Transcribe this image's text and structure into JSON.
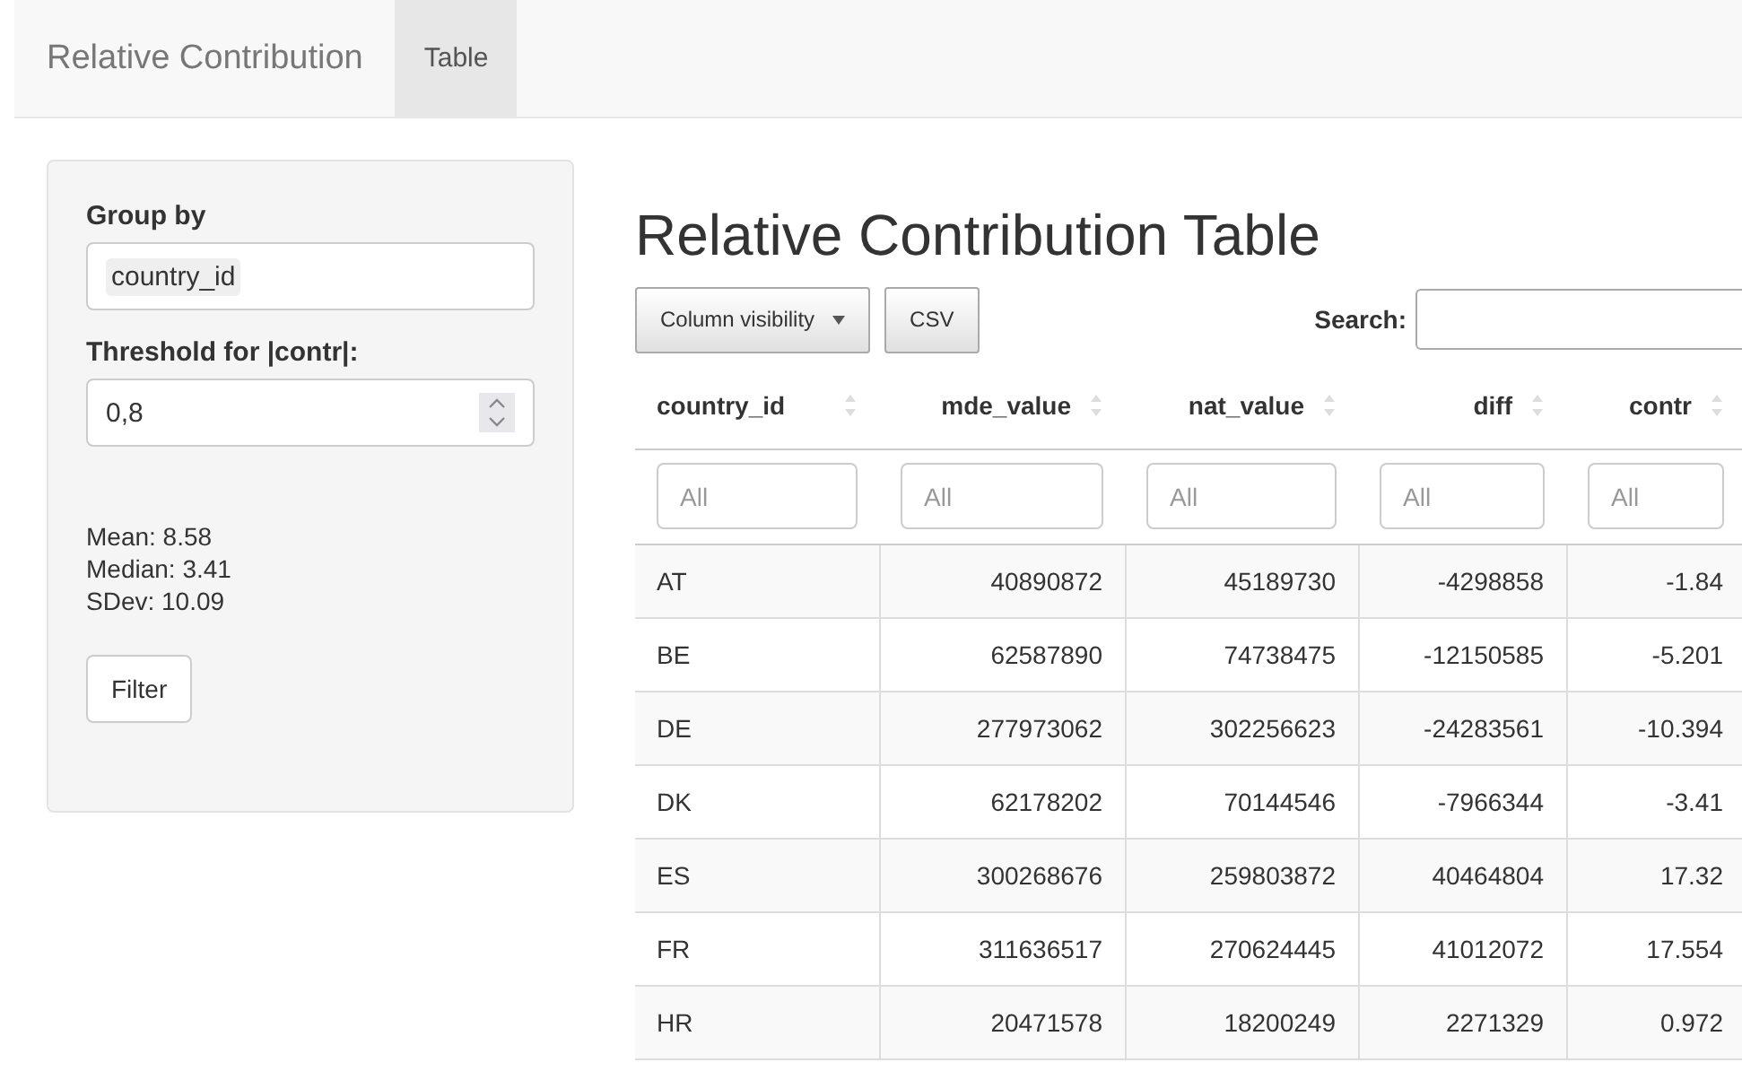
{
  "navbar": {
    "brand": "Relative Contribution",
    "tabs": [
      {
        "label": "Table",
        "selected": true
      }
    ]
  },
  "sidebar": {
    "group_by": {
      "label": "Group by",
      "value": "country_id"
    },
    "threshold": {
      "label": "Threshold for |contr|:",
      "value": "0,8"
    },
    "stats": [
      "Mean: 8.58",
      "Median: 3.41",
      "SDev: 10.09"
    ],
    "filter_button": "Filter"
  },
  "main": {
    "title": "Relative Contribution Table",
    "buttons": [
      {
        "label": "Column visibility",
        "kind": "dropdown"
      },
      {
        "label": "CSV",
        "kind": "plain"
      }
    ],
    "search_label": "Search:",
    "table": {
      "columns": [
        {
          "label": "country_id"
        },
        {
          "label": "mde_value"
        },
        {
          "label": "nat_value"
        },
        {
          "label": "diff"
        },
        {
          "label": "contr"
        }
      ],
      "filters": [
        {
          "placeholder": "All"
        },
        {
          "placeholder": "All"
        },
        {
          "placeholder": "All"
        },
        {
          "placeholder": "All"
        },
        {
          "placeholder": "All"
        }
      ],
      "rows": [
        [
          "AT",
          "40890872",
          "45189730",
          "-4298858",
          "-1.84"
        ],
        [
          "BE",
          "62587890",
          "74738475",
          "-12150585",
          "-5.201"
        ],
        [
          "DE",
          "277973062",
          "302256623",
          "-24283561",
          "-10.394"
        ],
        [
          "DK",
          "62178202",
          "70144546",
          "-7966344",
          "-3.41"
        ],
        [
          "ES",
          "300268676",
          "259803872",
          "40464804",
          "17.32"
        ],
        [
          "FR",
          "311636517",
          "270624445",
          "41012072",
          "17.554"
        ],
        [
          "HR",
          "20471578",
          "18200249",
          "2271329",
          "0.972"
        ]
      ]
    }
  }
}
